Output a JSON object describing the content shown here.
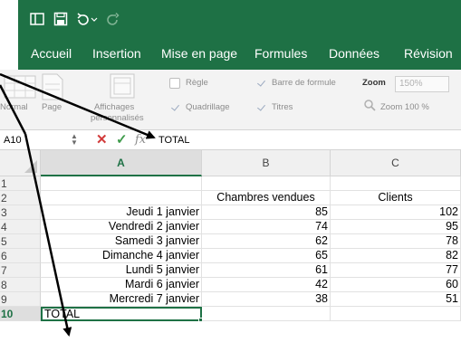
{
  "titlebar": {
    "icons": [
      "sidebar-toggle-icon",
      "save-icon",
      "undo-icon",
      "redo-icon"
    ],
    "accent_color": "#1e7145"
  },
  "ribbon_tabs": [
    "Accueil",
    "Insertion",
    "Mise en page",
    "Formules",
    "Données",
    "Révision"
  ],
  "ribbon": {
    "views": {
      "normal": "Normal",
      "page": "Page",
      "custom_line1": "Affichages",
      "custom_line2": "personnalisés"
    },
    "show": {
      "ruler": "Règle",
      "gridlines": "Quadrillage",
      "formula_bar": "Barre de formule",
      "headings": "Titres"
    },
    "show_checked": {
      "ruler": false,
      "gridlines": true,
      "formula_bar": true,
      "headings": true
    },
    "zoom": {
      "label": "Zoom",
      "value": "150%",
      "zoom100": "Zoom 100 %"
    }
  },
  "formula_bar": {
    "name_box": "A10",
    "cancel_symbol": "✕",
    "enter_symbol": "✓",
    "fx_label": "fx",
    "content": "TOTAL"
  },
  "grid": {
    "columns": [
      "A",
      "B",
      "C"
    ],
    "selected_column": "A",
    "rows": [
      {
        "num": "1",
        "a": "",
        "b": "",
        "c": ""
      },
      {
        "num": "2",
        "a": "",
        "b": "Chambres vendues",
        "c": "Clients"
      },
      {
        "num": "3",
        "a": "Jeudi 1 janvier",
        "b": "85",
        "c": "102"
      },
      {
        "num": "4",
        "a": "Vendredi 2 janvier",
        "b": "74",
        "c": "95"
      },
      {
        "num": "5",
        "a": "Samedi 3 janvier",
        "b": "62",
        "c": "78"
      },
      {
        "num": "6",
        "a": "Dimanche 4 janvier",
        "b": "65",
        "c": "82"
      },
      {
        "num": "7",
        "a": "Lundi 5 janvier",
        "b": "61",
        "c": "77"
      },
      {
        "num": "8",
        "a": "Mardi 6 janvier",
        "b": "42",
        "c": "60"
      },
      {
        "num": "9",
        "a": "Mercredi 7 janvier",
        "b": "38",
        "c": "51"
      },
      {
        "num": "10",
        "a": "TOTAL",
        "b": "",
        "c": ""
      }
    ],
    "selected_row": "10",
    "active_cell": "A10"
  }
}
